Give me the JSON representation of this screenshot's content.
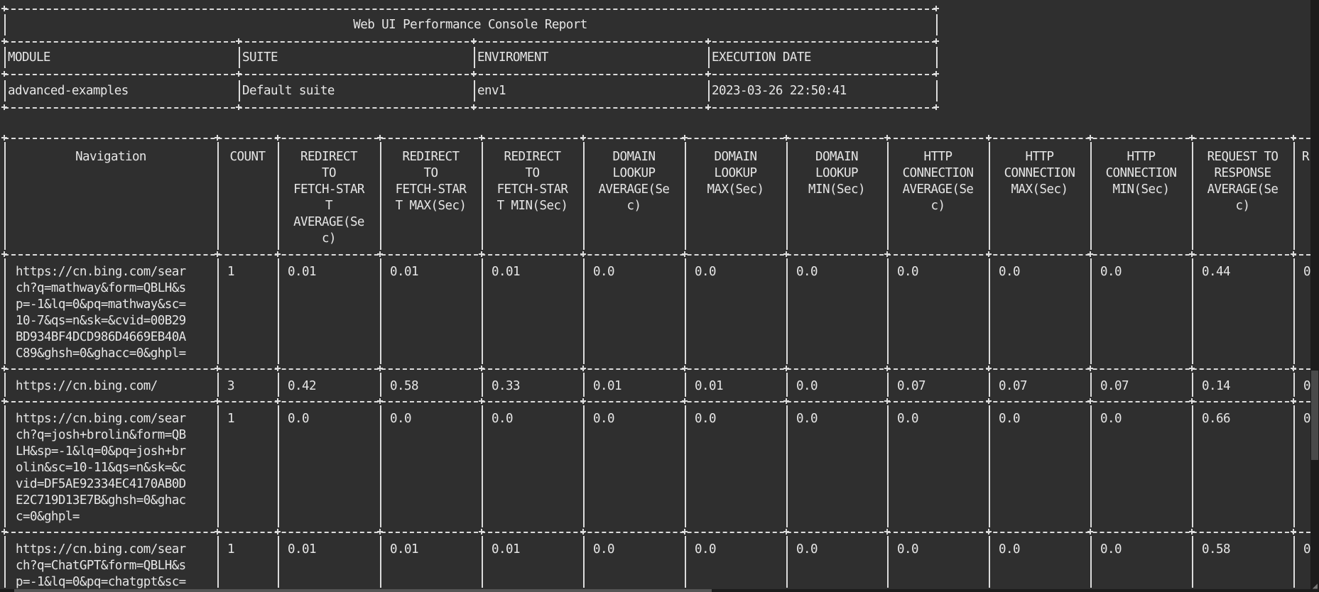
{
  "report": {
    "title": "Web UI Performance Console Report",
    "info_headers": [
      "MODULE",
      "SUITE",
      "ENVIROMENT",
      "EXECUTION DATE"
    ],
    "info_values": [
      "advanced-examples",
      "Default suite",
      "env1",
      "2023-03-26 22:50:41"
    ]
  },
  "table": {
    "columns": [
      {
        "lines": [
          "Navigation"
        ]
      },
      {
        "lines": [
          "COUNT"
        ]
      },
      {
        "lines": [
          "REDIRECT",
          "TO",
          "FETCH-STAR",
          "T",
          "AVERAGE(Se",
          "c)"
        ]
      },
      {
        "lines": [
          "REDIRECT",
          "TO",
          "FETCH-STAR",
          "T MAX(Sec)"
        ]
      },
      {
        "lines": [
          "REDIRECT",
          "TO",
          "FETCH-STAR",
          "T MIN(Sec)"
        ]
      },
      {
        "lines": [
          "DOMAIN",
          "LOOKUP",
          "AVERAGE(Se",
          "c)"
        ]
      },
      {
        "lines": [
          "DOMAIN",
          "LOOKUP",
          "MAX(Sec)"
        ]
      },
      {
        "lines": [
          "DOMAIN",
          "LOOKUP",
          "MIN(Sec)"
        ]
      },
      {
        "lines": [
          "HTTP",
          "CONNECTION",
          "AVERAGE(Se",
          "c)"
        ]
      },
      {
        "lines": [
          "HTTP",
          "CONNECTION",
          "MAX(Sec)"
        ]
      },
      {
        "lines": [
          "HTTP",
          "CONNECTION",
          "MIN(Sec)"
        ]
      },
      {
        "lines": [
          "REQUEST TO",
          "RESPONSE",
          "AVERAGE(Se",
          "c)"
        ]
      },
      {
        "lines": [
          "R"
        ]
      }
    ],
    "rows": [
      {
        "navigation_lines": [
          "https://cn.bing.com/sear",
          "ch?q=mathway&form=QBLH&s",
          "p=-1&lq=0&pq=mathway&sc=",
          "10-7&qs=n&sk=&cvid=00B29",
          "BD934BF4DCD986D4669EB40A",
          "C89&ghsh=0&ghacc=0&ghpl="
        ],
        "values": [
          "1",
          "0.01",
          "0.01",
          "0.01",
          "0.0",
          "0.0",
          "0.0",
          "0.0",
          "0.0",
          "0.0",
          "0.44",
          "0"
        ]
      },
      {
        "navigation_lines": [
          "https://cn.bing.com/"
        ],
        "values": [
          "3",
          "0.42",
          "0.58",
          "0.33",
          "0.01",
          "0.01",
          "0.0",
          "0.07",
          "0.07",
          "0.07",
          "0.14",
          "0"
        ]
      },
      {
        "navigation_lines": [
          "https://cn.bing.com/sear",
          "ch?q=josh+brolin&form=QB",
          "LH&sp=-1&lq=0&pq=josh+br",
          "olin&sc=10-11&qs=n&sk=&c",
          "vid=DF5AE92334EC4170AB0D",
          "E2C719D13E7B&ghsh=0&ghac",
          "c=0&ghpl="
        ],
        "values": [
          "1",
          "0.0",
          "0.0",
          "0.0",
          "0.0",
          "0.0",
          "0.0",
          "0.0",
          "0.0",
          "0.0",
          "0.66",
          "0"
        ]
      },
      {
        "navigation_lines": [
          "https://cn.bing.com/sear",
          "ch?q=ChatGPT&form=QBLH&s",
          "p=-1&lq=0&pq=chatgpt&sc="
        ],
        "values": [
          "1",
          "0.01",
          "0.01",
          "0.01",
          "0.0",
          "0.0",
          "0.0",
          "0.0",
          "0.0",
          "0.0",
          "0.58",
          "0"
        ]
      }
    ]
  },
  "scrollbar": {
    "corner_icon": "resize-grip-icon"
  }
}
